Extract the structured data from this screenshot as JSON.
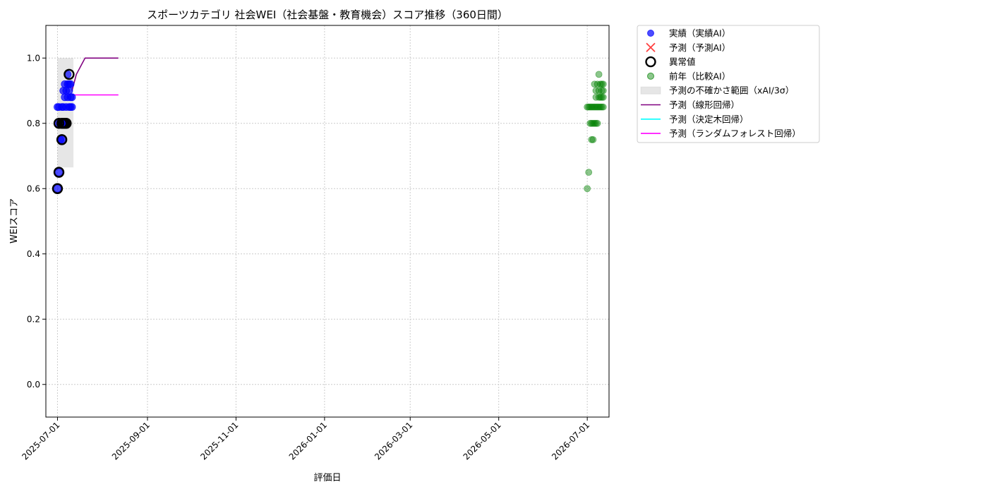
{
  "chart_data": {
    "type": "scatter",
    "title": "スポーツカテゴリ 社会WEI（社会基盤・教育機会）スコア推移（360日間）",
    "xlabel": "評価日",
    "ylabel": "WEIスコア",
    "x_is_date": true,
    "xlim": [
      "2025-06-23",
      "2026-07-16"
    ],
    "ylim": [
      -0.1,
      1.1
    ],
    "x_ticks": [
      "2025-07-01",
      "2025-09-01",
      "2025-11-01",
      "2026-01-01",
      "2026-03-01",
      "2026-05-01",
      "2026-07-01"
    ],
    "y_ticks": [
      0.0,
      0.2,
      0.4,
      0.6,
      0.8,
      1.0
    ],
    "grid": true,
    "legend_position": "outside-right",
    "series": [
      {
        "name": "実績（実績AI）",
        "kind": "scatter",
        "color": "#0000ff",
        "points": [
          {
            "x": "2025-07-01",
            "y": 0.6
          },
          {
            "x": "2025-07-01",
            "y": 0.85
          },
          {
            "x": "2025-07-02",
            "y": 0.65
          },
          {
            "x": "2025-07-02",
            "y": 0.8
          },
          {
            "x": "2025-07-02",
            "y": 0.85
          },
          {
            "x": "2025-07-03",
            "y": 0.75
          },
          {
            "x": "2025-07-03",
            "y": 0.8
          },
          {
            "x": "2025-07-04",
            "y": 0.75
          },
          {
            "x": "2025-07-04",
            "y": 0.85
          },
          {
            "x": "2025-07-05",
            "y": 0.8
          },
          {
            "x": "2025-07-05",
            "y": 0.85
          },
          {
            "x": "2025-07-05",
            "y": 0.9
          },
          {
            "x": "2025-07-06",
            "y": 0.8
          },
          {
            "x": "2025-07-06",
            "y": 0.88
          },
          {
            "x": "2025-07-06",
            "y": 0.92
          },
          {
            "x": "2025-07-07",
            "y": 0.8
          },
          {
            "x": "2025-07-07",
            "y": 0.85
          },
          {
            "x": "2025-07-07",
            "y": 0.9
          },
          {
            "x": "2025-07-08",
            "y": 0.88
          },
          {
            "x": "2025-07-08",
            "y": 0.92
          },
          {
            "x": "2025-07-08",
            "y": 0.95
          },
          {
            "x": "2025-07-09",
            "y": 0.85
          },
          {
            "x": "2025-07-09",
            "y": 0.9
          },
          {
            "x": "2025-07-09",
            "y": 0.92
          },
          {
            "x": "2025-07-10",
            "y": 0.85
          },
          {
            "x": "2025-07-10",
            "y": 0.88
          },
          {
            "x": "2025-07-10",
            "y": 0.92
          },
          {
            "x": "2025-07-11",
            "y": 0.85
          },
          {
            "x": "2025-07-11",
            "y": 0.88
          }
        ]
      },
      {
        "name": "予測（予測AI）",
        "kind": "scatter",
        "color": "#ff0000",
        "points": []
      },
      {
        "name": "異常値",
        "kind": "outlier",
        "color": "#000000",
        "points": [
          {
            "x": "2025-07-01",
            "y": 0.6
          },
          {
            "x": "2025-07-02",
            "y": 0.65
          },
          {
            "x": "2025-07-02",
            "y": 0.8
          },
          {
            "x": "2025-07-04",
            "y": 0.75
          },
          {
            "x": "2025-07-04",
            "y": 0.8
          },
          {
            "x": "2025-07-05",
            "y": 0.8
          },
          {
            "x": "2025-07-06",
            "y": 0.8
          },
          {
            "x": "2025-07-07",
            "y": 0.8
          },
          {
            "x": "2025-07-09",
            "y": 0.95
          }
        ]
      },
      {
        "name": "前年（比較AI）",
        "kind": "scatter",
        "color": "#008000",
        "points": [
          {
            "x": "2026-07-01",
            "y": 0.6
          },
          {
            "x": "2026-07-01",
            "y": 0.85
          },
          {
            "x": "2026-07-02",
            "y": 0.65
          },
          {
            "x": "2026-07-02",
            "y": 0.85
          },
          {
            "x": "2026-07-03",
            "y": 0.8
          },
          {
            "x": "2026-07-03",
            "y": 0.85
          },
          {
            "x": "2026-07-04",
            "y": 0.75
          },
          {
            "x": "2026-07-04",
            "y": 0.8
          },
          {
            "x": "2026-07-04",
            "y": 0.85
          },
          {
            "x": "2026-07-05",
            "y": 0.75
          },
          {
            "x": "2026-07-05",
            "y": 0.8
          },
          {
            "x": "2026-07-05",
            "y": 0.85
          },
          {
            "x": "2026-07-06",
            "y": 0.8
          },
          {
            "x": "2026-07-06",
            "y": 0.85
          },
          {
            "x": "2026-07-06",
            "y": 0.92
          },
          {
            "x": "2026-07-07",
            "y": 0.8
          },
          {
            "x": "2026-07-07",
            "y": 0.85
          },
          {
            "x": "2026-07-07",
            "y": 0.88
          },
          {
            "x": "2026-07-07",
            "y": 0.9
          },
          {
            "x": "2026-07-08",
            "y": 0.8
          },
          {
            "x": "2026-07-08",
            "y": 0.85
          },
          {
            "x": "2026-07-08",
            "y": 0.92
          },
          {
            "x": "2026-07-09",
            "y": 0.85
          },
          {
            "x": "2026-07-09",
            "y": 0.88
          },
          {
            "x": "2026-07-09",
            "y": 0.9
          },
          {
            "x": "2026-07-09",
            "y": 0.95
          },
          {
            "x": "2026-07-10",
            "y": 0.85
          },
          {
            "x": "2026-07-10",
            "y": 0.88
          },
          {
            "x": "2026-07-10",
            "y": 0.92
          },
          {
            "x": "2026-07-11",
            "y": 0.85
          },
          {
            "x": "2026-07-11",
            "y": 0.88
          },
          {
            "x": "2026-07-11",
            "y": 0.9
          },
          {
            "x": "2026-07-11",
            "y": 0.92
          },
          {
            "x": "2026-07-12",
            "y": 0.85
          },
          {
            "x": "2026-07-12",
            "y": 0.88
          },
          {
            "x": "2026-07-12",
            "y": 0.9
          },
          {
            "x": "2026-07-12",
            "y": 0.92
          }
        ]
      },
      {
        "name": "予測の不確かさ範囲（xAI/3σ）",
        "kind": "band",
        "color": "#808080",
        "x0": "2025-07-01",
        "x1": "2025-07-12",
        "y0": 0.665,
        "y1": 1.0
      },
      {
        "name": "予測（線形回帰）",
        "kind": "line",
        "color": "#800080",
        "points": [
          {
            "x": "2025-07-11",
            "y": 0.9
          },
          {
            "x": "2025-07-14",
            "y": 0.95
          },
          {
            "x": "2025-07-20",
            "y": 1.0
          },
          {
            "x": "2025-08-12",
            "y": 1.0
          }
        ]
      },
      {
        "name": "予測（決定木回帰）",
        "kind": "line",
        "color": "#00ffff",
        "points": []
      },
      {
        "name": "予測（ランダムフォレスト回帰）",
        "kind": "line",
        "color": "#ff00ff",
        "points": [
          {
            "x": "2025-07-11",
            "y": 0.887
          },
          {
            "x": "2025-08-12",
            "y": 0.887
          }
        ]
      }
    ]
  }
}
